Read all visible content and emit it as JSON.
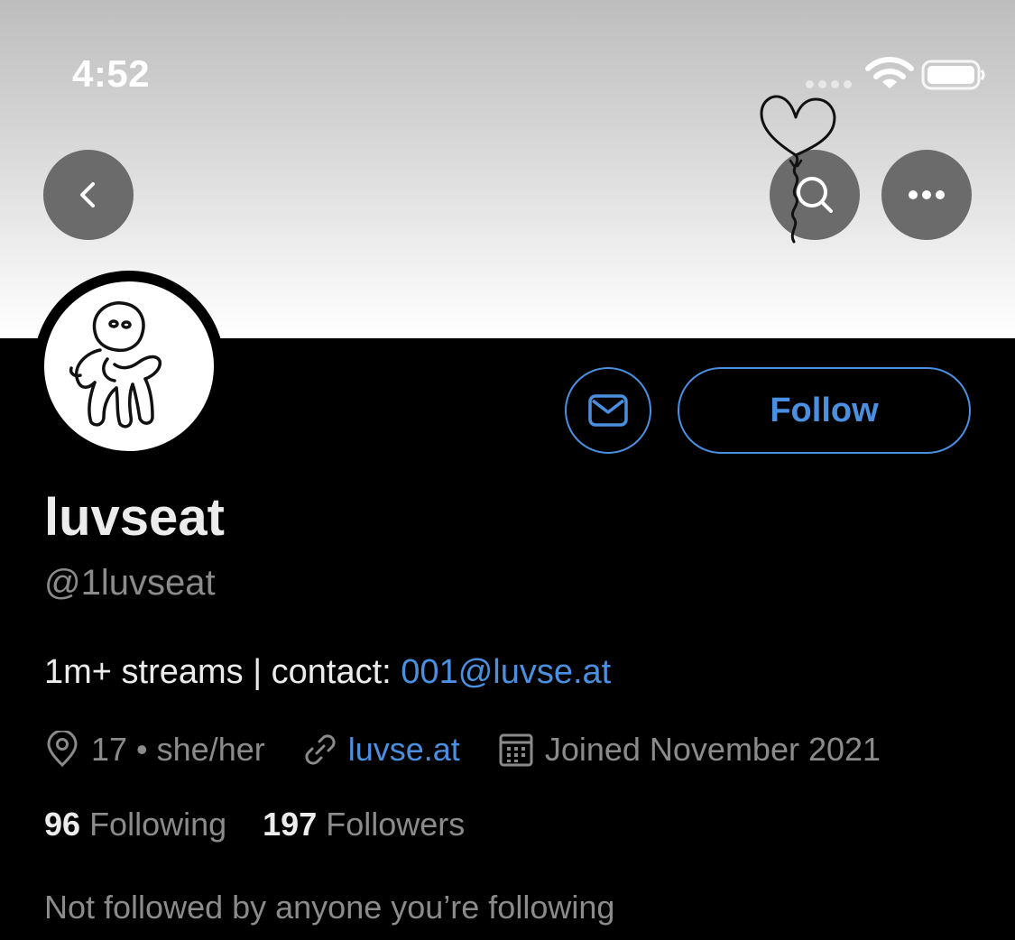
{
  "status_bar": {
    "time": "4:52"
  },
  "profile": {
    "display_name": "luvseat",
    "handle": "@1luvseat",
    "bio_text": "1m+ streams | contact: ",
    "bio_email": "001@luvse.at",
    "location": "17 • she/her",
    "website": "luvse.at",
    "joined": "Joined November 2021",
    "following_count": "96",
    "following_label": "Following",
    "followers_count": "197",
    "followers_label": "Followers",
    "followed_by_note": "Not followed by anyone you’re following"
  },
  "actions": {
    "follow_label": "Follow"
  },
  "icons": {
    "back": "chevron-left-icon",
    "search": "search-icon",
    "more": "more-horizontal-icon",
    "message": "mail-icon",
    "location": "location-pin-icon",
    "link": "link-icon",
    "calendar": "calendar-icon"
  },
  "colors": {
    "accent": "#4a8fe0",
    "background": "#000000",
    "text_primary": "#ececec",
    "text_secondary": "#8b8b8b"
  }
}
